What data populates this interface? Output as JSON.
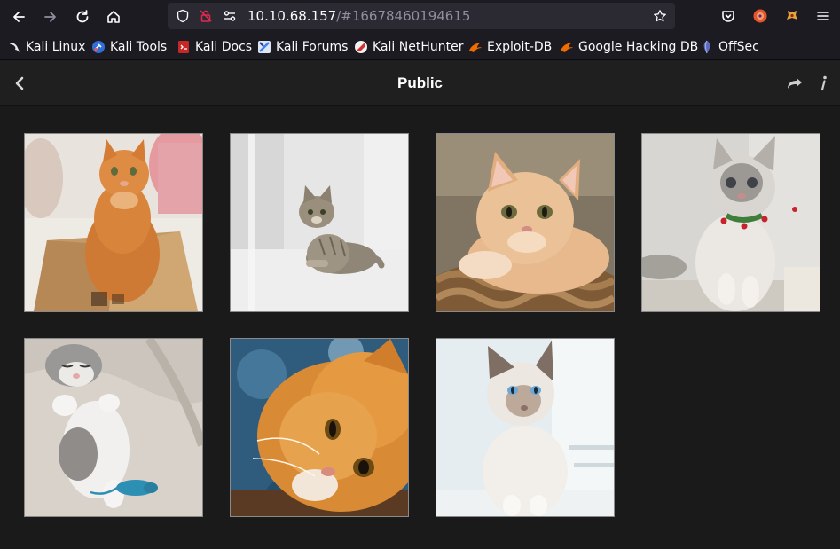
{
  "browser": {
    "url_host": "10.10.68.157",
    "url_path": "/#16678460194615"
  },
  "bookmarks": [
    {
      "label": "Kali Linux",
      "icon": "kali-dragon-icon",
      "color": "#367bf0"
    },
    {
      "label": "Kali Tools",
      "icon": "kali-tools-icon",
      "color": "#2f6fd6"
    },
    {
      "label": "Kali Docs",
      "icon": "kali-docs-icon",
      "color": "#c62828"
    },
    {
      "label": "Kali Forums",
      "icon": "kali-forums-icon",
      "color": "#3b82f6"
    },
    {
      "label": "Kali NetHunter",
      "icon": "kali-nethunter-icon",
      "color": "#d32f2f"
    },
    {
      "label": "Exploit-DB",
      "icon": "exploit-db-icon",
      "color": "#ef6c00"
    },
    {
      "label": "Google Hacking DB",
      "icon": "ghdb-icon",
      "color": "#ef6c00"
    },
    {
      "label": "OffSec",
      "icon": "offsec-icon",
      "color": "#5c6bc0"
    }
  ],
  "app": {
    "title": "Public"
  },
  "gallery": {
    "images": [
      {
        "name": "ginger-cat-in-box"
      },
      {
        "name": "tabby-kitten-lying"
      },
      {
        "name": "cream-cat-in-basket"
      },
      {
        "name": "fluffy-grey-white-cat"
      },
      {
        "name": "sleeping-grey-kitten-with-toy"
      },
      {
        "name": "ginger-cat-closeup"
      },
      {
        "name": "siamese-kitten"
      }
    ]
  }
}
